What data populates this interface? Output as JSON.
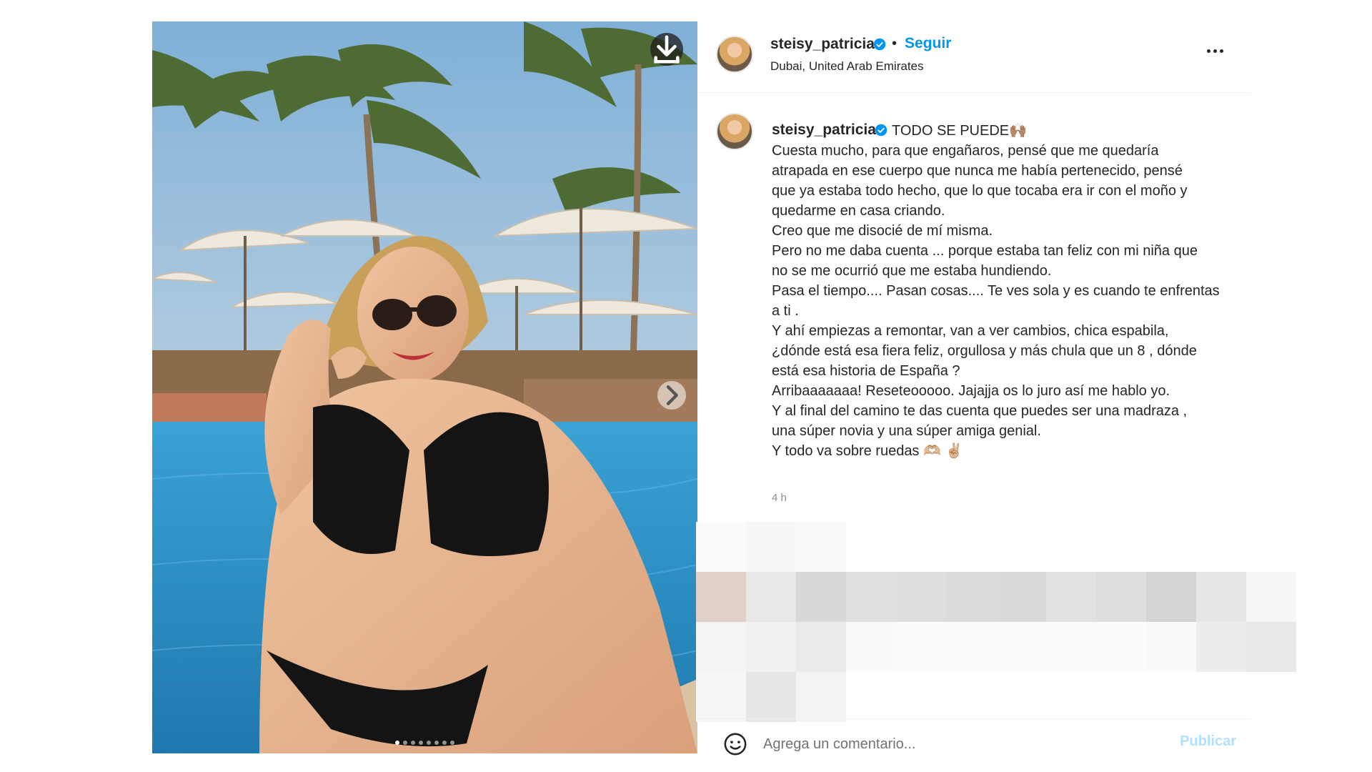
{
  "post": {
    "image_alt": "Woman in black bikini posing in a pool under palm trees and parasols",
    "carousel": {
      "count": 8,
      "active": 0
    }
  },
  "header": {
    "username": "steisy_patricia",
    "separator": "•",
    "follow_label": "Seguir",
    "location": "Dubai, United Arab Emirates"
  },
  "caption": {
    "username": "steisy_patricia",
    "title": "TODO SE PUEDE🙌🏽",
    "lines": [
      "Cuesta mucho, para que engañaros, pensé que me quedaría",
      "atrapada en ese cuerpo que nunca me había pertenecido, pensé",
      "que ya estaba todo hecho, que lo que tocaba era ir con el moño y",
      "quedarme en casa criando.",
      "Creo que me disocié de mí misma.",
      "Pero no me daba cuenta ... porque estaba tan feliz con mi niña que",
      "no se me ocurrió que me estaba hundiendo.",
      "Pasa el tiempo.... Pasan cosas.... Te ves sola y es cuando te enfrentas",
      "a ti .",
      "Y ahí empiezas a remontar, van a ver cambios, chica espabila,",
      "¿dónde está esa fiera feliz, orgullosa y más chula que un 8 , dónde",
      "está esa historia de España ?",
      "Arribaaaaaaa! Reseteooooo. Jajajja os lo juro así me hablo yo.",
      "Y al final del camino te das cuenta que puedes ser una madraza ,",
      "una súper novia y una súper amiga genial.",
      "Y todo va sobre ruedas 🫶🏼 ✌🏼"
    ],
    "timestamp": "4 h"
  },
  "comment_bar": {
    "placeholder": "Agrega un comentario...",
    "publish_label": "Publicar"
  },
  "colors": {
    "link_blue": "#0095f6",
    "publish_disabled": "#b2dffc",
    "text": "#262626",
    "muted": "#8e8e8e",
    "divider": "#efefef"
  },
  "icons": [
    "download-icon",
    "chevron-right-icon",
    "verified-badge-icon",
    "more-options-icon",
    "emoji-icon"
  ]
}
